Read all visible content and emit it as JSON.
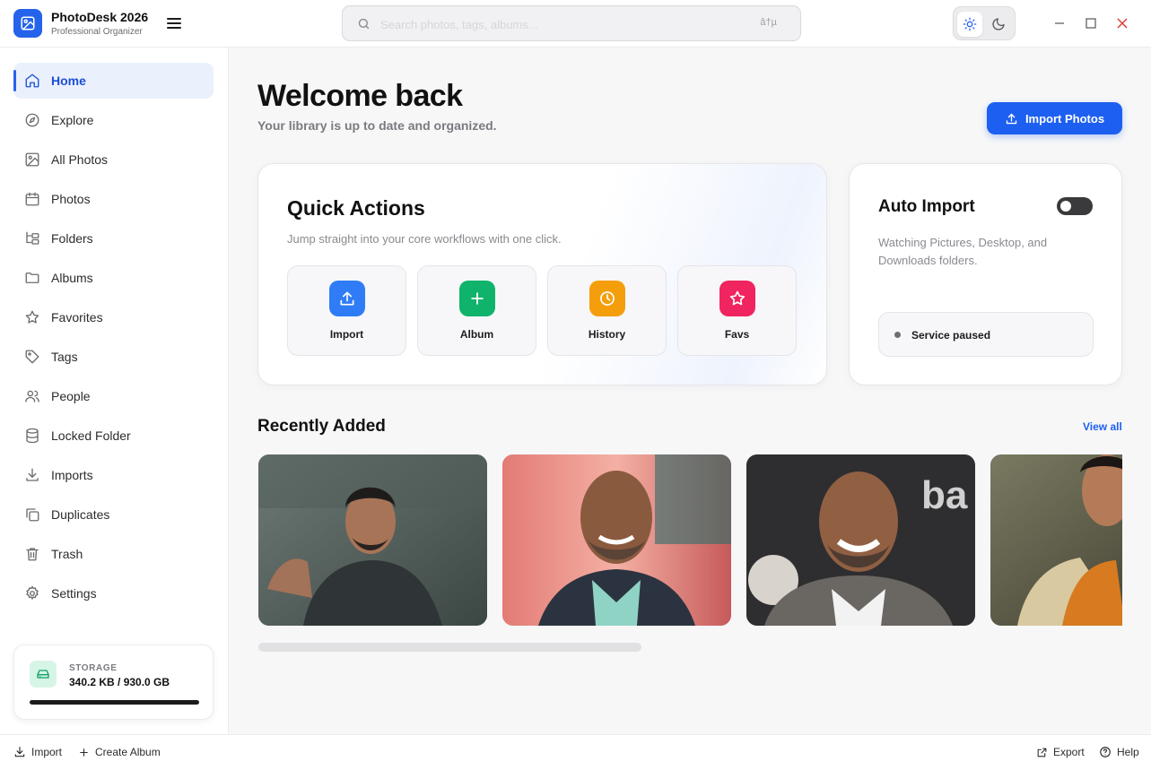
{
  "app": {
    "name": "PhotoDesk 2026",
    "subtitle": "Professional Organizer"
  },
  "search": {
    "placeholder": "Search photos, tags, albums...",
    "shortcut": "â†µ"
  },
  "theme": {
    "mode": "light"
  },
  "sidebar": {
    "items": [
      {
        "label": "Home",
        "icon": "home-icon",
        "active": true
      },
      {
        "label": "Explore",
        "icon": "compass-icon"
      },
      {
        "label": "All Photos",
        "icon": "image-icon"
      },
      {
        "label": "Photos",
        "icon": "calendar-icon"
      },
      {
        "label": "Folders",
        "icon": "folder-tree-icon"
      },
      {
        "label": "Albums",
        "icon": "folder-icon"
      },
      {
        "label": "Favorites",
        "icon": "star-icon"
      },
      {
        "label": "Tags",
        "icon": "tag-icon"
      },
      {
        "label": "People",
        "icon": "people-icon"
      },
      {
        "label": "Locked Folder",
        "icon": "database-icon"
      },
      {
        "label": "Imports",
        "icon": "download-icon"
      },
      {
        "label": "Duplicates",
        "icon": "copy-icon"
      },
      {
        "label": "Trash",
        "icon": "trash-icon"
      },
      {
        "label": "Settings",
        "icon": "gear-icon"
      }
    ],
    "storage": {
      "title": "STORAGE",
      "value": "340.2 KB / 930.0 GB",
      "used_fraction": 0.0
    }
  },
  "main": {
    "welcome_title": "Welcome back",
    "welcome_subtitle": "Your library is up to date and organized.",
    "import_button": "Import Photos",
    "quick_actions": {
      "title": "Quick Actions",
      "subtitle": "Jump straight into your core workflows with one click.",
      "tiles": [
        {
          "label": "Import",
          "icon": "upload-icon",
          "color": "#2f7cf6"
        },
        {
          "label": "Album",
          "icon": "plus-icon",
          "color": "#10b36b"
        },
        {
          "label": "History",
          "icon": "clock-icon",
          "color": "#f59e0b"
        },
        {
          "label": "Favs",
          "icon": "star-icon",
          "color": "#f0245e"
        }
      ]
    },
    "auto_import": {
      "title": "Auto Import",
      "enabled": false,
      "description": "Watching Pictures, Desktop, and Downloads folders.",
      "status": "Service paused"
    },
    "recent": {
      "title": "Recently Added",
      "view_all": "View all"
    }
  },
  "bottombar": {
    "import": "Import",
    "create_album": "Create Album",
    "export": "Export",
    "help": "Help"
  },
  "colors": {
    "accent": "#1d5ff0",
    "active_nav_bg": "#eaf1fd"
  }
}
